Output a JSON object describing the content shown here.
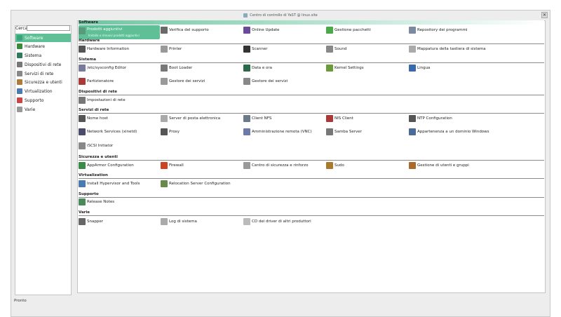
{
  "window": {
    "title": "Centro di controllo di YaST @ linux.site",
    "close_glyph": "✕"
  },
  "sidebar": {
    "search_label": "Cerca",
    "search_value": "",
    "items": [
      {
        "label": "Software",
        "icon": "software-icon",
        "color": "#3aa57a"
      },
      {
        "label": "Hardware",
        "icon": "hardware-icon",
        "color": "#3a8a3a"
      },
      {
        "label": "Sistema",
        "icon": "system-icon",
        "color": "#2f7a5a"
      },
      {
        "label": "Dispositivi di rete",
        "icon": "network-devices-icon",
        "color": "#777777"
      },
      {
        "label": "Servizi di rete",
        "icon": "network-services-icon",
        "color": "#888888"
      },
      {
        "label": "Sicurezza e utenti",
        "icon": "security-icon",
        "color": "#b07a3a"
      },
      {
        "label": "Virtualization",
        "icon": "virtualization-icon",
        "color": "#4a7ab0"
      },
      {
        "label": "Supporto",
        "icon": "support-icon",
        "color": "#cc4444"
      },
      {
        "label": "Varie",
        "icon": "misc-icon",
        "color": "#999999"
      }
    ]
  },
  "sections": [
    {
      "title": "Software",
      "modules": [
        {
          "label": "Prodotti aggiuntivi",
          "sub": "Installa o rimuovi prodotti aggiuntivi",
          "icon": "addon-icon",
          "color": "#5a9a7a",
          "selected": true
        },
        {
          "label": "Verifica del supporto",
          "icon": "media-check-icon",
          "color": "#6a6a6a"
        },
        {
          "label": "Online Update",
          "icon": "online-update-icon",
          "color": "#6a4a9a"
        },
        {
          "label": "Gestione pacchetti",
          "icon": "package-icon",
          "color": "#4aaa4a"
        },
        {
          "label": "Repository dei programmi",
          "icon": "repository-icon",
          "color": "#7a8aa0"
        }
      ]
    },
    {
      "title": "Hardware",
      "modules": [
        {
          "label": "Hardware Information",
          "icon": "hardware-info-icon",
          "color": "#555555"
        },
        {
          "label": "Printer",
          "icon": "printer-icon",
          "color": "#999999"
        },
        {
          "label": "Scanner",
          "icon": "scanner-icon",
          "color": "#333333"
        },
        {
          "label": "Sound",
          "icon": "sound-icon",
          "color": "#888888"
        },
        {
          "label": "Mappatura della tastiera di sistema",
          "icon": "keyboard-icon",
          "color": "#aaaaaa"
        }
      ]
    },
    {
      "title": "Sistema",
      "modules": [
        {
          "label": "/etc/sysconfig Editor",
          "icon": "sysconfig-icon",
          "color": "#7a7a9a"
        },
        {
          "label": "Boot Loader",
          "icon": "bootloader-icon",
          "color": "#777777"
        },
        {
          "label": "Data e ora",
          "icon": "clock-icon",
          "color": "#2a6a4a"
        },
        {
          "label": "Kernel Settings",
          "icon": "kernel-icon",
          "color": "#6a9a3a"
        },
        {
          "label": "Lingua",
          "icon": "language-icon",
          "color": "#3a6aaa"
        },
        {
          "label": "Partizionatore",
          "icon": "partitioner-icon",
          "color": "#aa3a3a"
        },
        {
          "label": "Gestore dei servizi",
          "icon": "services-icon",
          "color": "#999999"
        },
        {
          "label": "Gestore dei servizi",
          "icon": "services-manager-icon",
          "color": "#888888"
        }
      ]
    },
    {
      "title": "Dispositivi di rete",
      "modules": [
        {
          "label": "Impostazioni di rete",
          "icon": "network-settings-icon",
          "color": "#777777"
        }
      ]
    },
    {
      "title": "Servizi di rete",
      "modules": [
        {
          "label": "Nome host",
          "icon": "hostname-icon",
          "color": "#555555"
        },
        {
          "label": "Server di posta elettronica",
          "icon": "mail-server-icon",
          "color": "#aaaaaa"
        },
        {
          "label": "Client NFS",
          "icon": "nfs-client-icon",
          "color": "#6a7a8a"
        },
        {
          "label": "NIS Client",
          "icon": "nis-client-icon",
          "color": "#aa3a3a"
        },
        {
          "label": "NTP Configuration",
          "icon": "ntp-icon",
          "color": "#555555"
        },
        {
          "label": "Network Services (xinetd)",
          "icon": "xinetd-icon",
          "color": "#4a4a6a"
        },
        {
          "label": "Proxy",
          "icon": "proxy-icon",
          "color": "#555555"
        },
        {
          "label": "Amministrazione remota (VNC)",
          "icon": "vnc-icon",
          "color": "#6a7aaa"
        },
        {
          "label": "Samba Server",
          "icon": "samba-icon",
          "color": "#777777"
        },
        {
          "label": "Appartenenza a un dominio Windows",
          "icon": "windows-domain-icon",
          "color": "#4a6a9a"
        },
        {
          "label": "iSCSI Initiator",
          "icon": "iscsi-icon",
          "color": "#888888"
        }
      ]
    },
    {
      "title": "Sicurezza e utenti",
      "modules": [
        {
          "label": "AppArmor Configuration",
          "icon": "apparmor-icon",
          "color": "#3a8a4a"
        },
        {
          "label": "Firewall",
          "icon": "firewall-icon",
          "color": "#cc4422"
        },
        {
          "label": "Centro di sicurezza e rinforzo",
          "icon": "security-center-icon",
          "color": "#999999"
        },
        {
          "label": "Sudo",
          "icon": "sudo-icon",
          "color": "#aa7a2a"
        },
        {
          "label": "Gestione di utenti e gruppi",
          "icon": "users-icon",
          "color": "#aa6a2a"
        }
      ]
    },
    {
      "title": "Virtualization",
      "modules": [
        {
          "label": "Install Hypervisor and Tools",
          "icon": "hypervisor-icon",
          "color": "#4a7ab0"
        },
        {
          "label": "Relocation Server Configuration",
          "icon": "relocation-icon",
          "color": "#6a8a4a"
        }
      ]
    },
    {
      "title": "Supporto",
      "modules": [
        {
          "label": "Release Notes",
          "icon": "release-notes-icon",
          "color": "#4a8a5a"
        }
      ]
    },
    {
      "title": "Varie",
      "modules": [
        {
          "label": "Snapper",
          "icon": "snapper-icon",
          "color": "#666666"
        },
        {
          "label": "Log di sistema",
          "icon": "system-log-icon",
          "color": "#aaaaaa"
        },
        {
          "label": "CD dei driver di altri produttori",
          "icon": "driver-cd-icon",
          "color": "#bbbbbb"
        }
      ]
    }
  ],
  "status": "Pronto"
}
